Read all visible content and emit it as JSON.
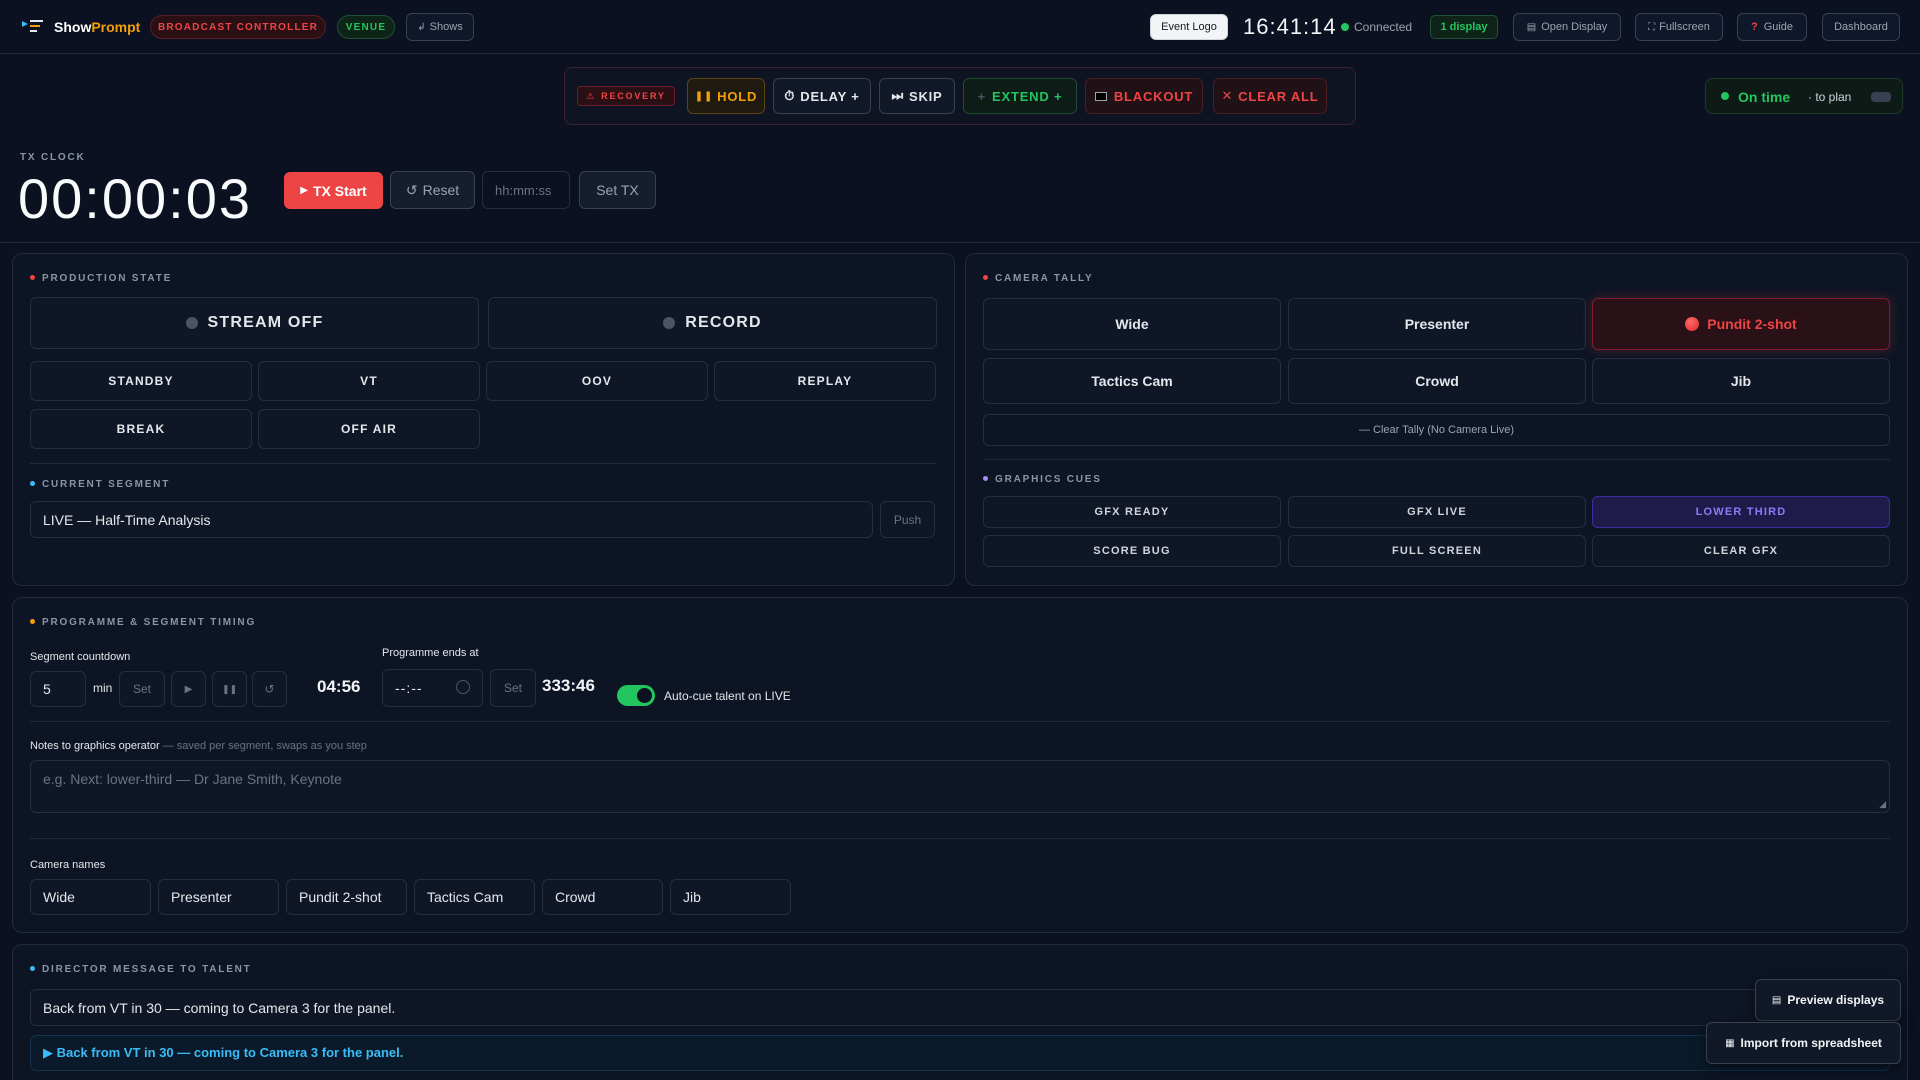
{
  "app": {
    "name_part1": "Show",
    "name_part2": "Prompt",
    "role_badge": "BROADCAST CONTROLLER",
    "venue_badge": "VENUE",
    "shows_label": "Shows"
  },
  "topbar": {
    "event_logo": "Event Logo",
    "clock": "16:41:14",
    "connection": "Connected",
    "displays": "1 display",
    "open_display": "Open Display",
    "fullscreen": "Fullscreen",
    "guide": "Guide",
    "dashboard": "Dashboard"
  },
  "controls": {
    "recovery": "RECOVERY",
    "hold": "HOLD",
    "delay": "DELAY +",
    "skip": "SKIP",
    "extend": "EXTEND +",
    "blackout": "BLACKOUT",
    "clear_all": "CLEAR ALL"
  },
  "status": {
    "on_time": "On time",
    "to_plan": "· to plan"
  },
  "tx": {
    "label": "TX CLOCK",
    "time": "00:00:03",
    "start": "TX Start",
    "reset": "Reset",
    "input_placeholder": "hh:mm:ss",
    "set": "Set TX"
  },
  "production": {
    "label": "PRODUCTION STATE",
    "stream": "STREAM OFF",
    "record": "RECORD",
    "states": [
      "STANDBY",
      "VT",
      "OOV",
      "REPLAY",
      "BREAK",
      "OFF AIR"
    ]
  },
  "segment": {
    "label": "CURRENT SEGMENT",
    "value": "LIVE — Half-Time Analysis",
    "push": "Push"
  },
  "tally": {
    "label": "CAMERA TALLY",
    "cameras": [
      "Wide",
      "Presenter",
      "Pundit 2-shot",
      "Tactics Cam",
      "Crowd",
      "Jib"
    ],
    "live_index": 2,
    "clear": "— Clear Tally (No Camera Live)"
  },
  "graphics": {
    "label": "GRAPHICS CUES",
    "cues": [
      "GFX READY",
      "GFX LIVE",
      "LOWER THIRD",
      "SCORE BUG",
      "FULL SCREEN",
      "CLEAR GFX"
    ],
    "active_index": 2
  },
  "timing": {
    "label": "PROGRAMME & SEGMENT TIMING",
    "countdown_label": "Segment countdown",
    "minutes": "5",
    "min_unit": "min",
    "set": "Set",
    "countdown": "04:56",
    "prog_end_label": "Programme ends at",
    "prog_end_value": "--:--",
    "prog_set": "Set",
    "prog_remaining": "333:46",
    "autocue_label": "Auto-cue talent on LIVE",
    "autocue_on": true,
    "notes_label": "Notes to graphics operator",
    "notes_hint": "— saved per segment, swaps as you step",
    "notes_placeholder": "e.g. Next: lower-third — Dr Jane Smith, Keynote",
    "camera_names_label": "Camera names",
    "camera_names": [
      "Wide",
      "Presenter",
      "Pundit 2-shot",
      "Tactics Cam",
      "Crowd",
      "Jib"
    ]
  },
  "director": {
    "label": "DIRECTOR MESSAGE TO TALENT",
    "input": "Back from VT in 30 — coming to Camera 3 for the panel.",
    "sent": "▶ Back from VT in 30 — coming to Camera 3 for the panel.",
    "preview": "Preview displays",
    "import": "Import from spreadsheet"
  },
  "colors": {
    "accent_red": "#ef4444",
    "accent_orange": "#f59e0b",
    "accent_green": "#22c55e",
    "accent_cyan": "#38bdf8",
    "accent_purple": "#a78bfa"
  }
}
